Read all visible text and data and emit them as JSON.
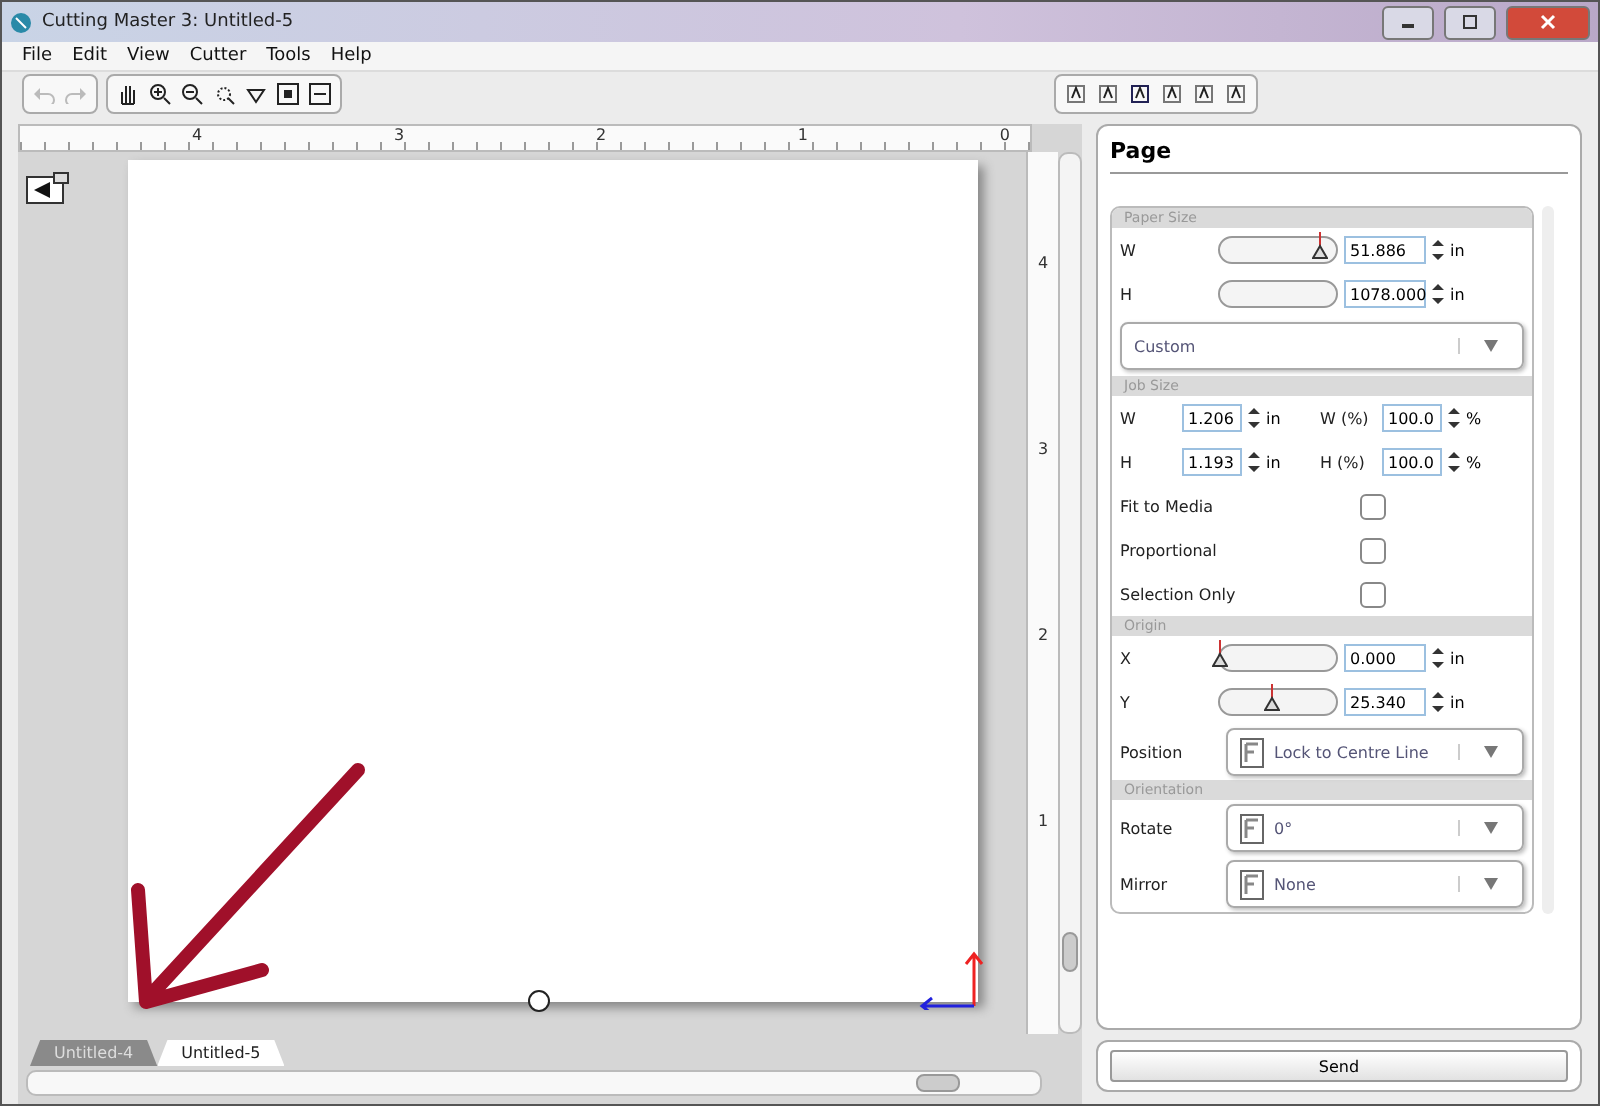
{
  "window": {
    "title": "Cutting Master 3: Untitled-5"
  },
  "menu": [
    "File",
    "Edit",
    "View",
    "Cutter",
    "Tools",
    "Help"
  ],
  "ruler": {
    "horizontal": [
      "4",
      "3",
      "2",
      "1",
      "0"
    ],
    "vertical": [
      "4",
      "3",
      "2",
      "1"
    ]
  },
  "document_tabs": [
    {
      "label": "Untitled-4",
      "selected": false
    },
    {
      "label": "Untitled-5",
      "selected": true
    }
  ],
  "panel": {
    "title": "Page",
    "sections": [
      {
        "title": "Paper Size",
        "rows": [
          {
            "kind": "slider",
            "label": "W",
            "level": 0.87,
            "value": "51.886",
            "unit": "in"
          },
          {
            "kind": "slider",
            "label": "H",
            "value": "1078.000",
            "unit": "in"
          },
          {
            "kind": "dropdown",
            "value": "Custom"
          }
        ]
      },
      {
        "title": "Job Size",
        "rows": [
          {
            "kind": "pair",
            "label": "W",
            "value": "1.206",
            "unit": "in",
            "label2": "W (%)",
            "value2": "100.0",
            "unit2": "%"
          },
          {
            "kind": "pair",
            "label": "H",
            "value": "1.193",
            "unit": "in",
            "label2": "H (%)",
            "value2": "100.0",
            "unit2": "%"
          },
          {
            "kind": "checkbox",
            "label": "Fit to Media",
            "checked": false
          },
          {
            "kind": "checkbox",
            "label": "Proportional",
            "checked": false
          },
          {
            "kind": "checkbox",
            "label": "Selection Only",
            "checked": false
          }
        ]
      },
      {
        "title": "Origin",
        "rows": [
          {
            "kind": "slider",
            "label": "X",
            "level": 0,
            "value": "0.000",
            "unit": "in"
          },
          {
            "kind": "slider",
            "label": "Y",
            "level": 0.45,
            "value": "25.340",
            "unit": "in"
          },
          {
            "kind": "dropdown",
            "label": "Position",
            "value": "Lock to Centre Line"
          }
        ]
      },
      {
        "title": "Orientation",
        "rows": [
          {
            "kind": "dropdown",
            "label": "Rotate",
            "value": "0°"
          },
          {
            "kind": "dropdown",
            "label": "Mirror",
            "value": "None"
          }
        ]
      }
    ]
  },
  "send_button": "Send"
}
